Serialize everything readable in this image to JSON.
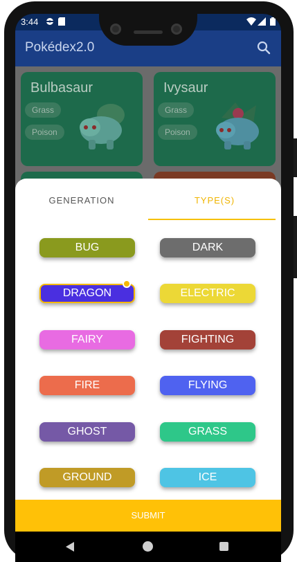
{
  "status_bar": {
    "time": "3:44",
    "left_icons": [
      "pokeball-notification-icon",
      "sd-card-icon"
    ],
    "right_icons": [
      "wifi-icon",
      "signal-icon",
      "battery-icon"
    ]
  },
  "app_bar": {
    "title": "Pokédex2.0",
    "search_icon": "search-icon",
    "background": "#1a3e86"
  },
  "pokemon_cards": [
    {
      "name": "Bulbasaur",
      "types": [
        "Grass",
        "Poison"
      ],
      "color": "#1d6a4b"
    },
    {
      "name": "Ivysaur",
      "types": [
        "Grass",
        "Poison"
      ],
      "color": "#1d6a4b"
    }
  ],
  "filter_sheet": {
    "tabs": [
      {
        "label": "GENERATION",
        "selected": false
      },
      {
        "label": "TYPE(S)",
        "selected": true
      }
    ],
    "types": [
      {
        "label": "BUG",
        "color": "#8a9a1e",
        "selected": false
      },
      {
        "label": "DARK",
        "color": "#6d6d6d",
        "selected": false
      },
      {
        "label": "DRAGON",
        "color": "#4a2fe0",
        "selected": true
      },
      {
        "label": "ELECTRIC",
        "color": "#ecd836",
        "selected": false
      },
      {
        "label": "FAIRY",
        "color": "#e86be2",
        "selected": false
      },
      {
        "label": "FIGHTING",
        "color": "#a34238",
        "selected": false
      },
      {
        "label": "FIRE",
        "color": "#ec6c4c",
        "selected": false
      },
      {
        "label": "FLYING",
        "color": "#4f62f0",
        "selected": false
      },
      {
        "label": "GHOST",
        "color": "#7559a6",
        "selected": false
      },
      {
        "label": "GRASS",
        "color": "#2ec789",
        "selected": false
      },
      {
        "label": "GROUND",
        "color": "#c09b26",
        "selected": false
      },
      {
        "label": "ICE",
        "color": "#4ec4e4",
        "selected": false
      }
    ],
    "submit_label": "SUBMIT",
    "accent": "#ffc107"
  },
  "nav_bar": {
    "icons": [
      "back-icon",
      "home-icon",
      "recents-icon"
    ]
  }
}
